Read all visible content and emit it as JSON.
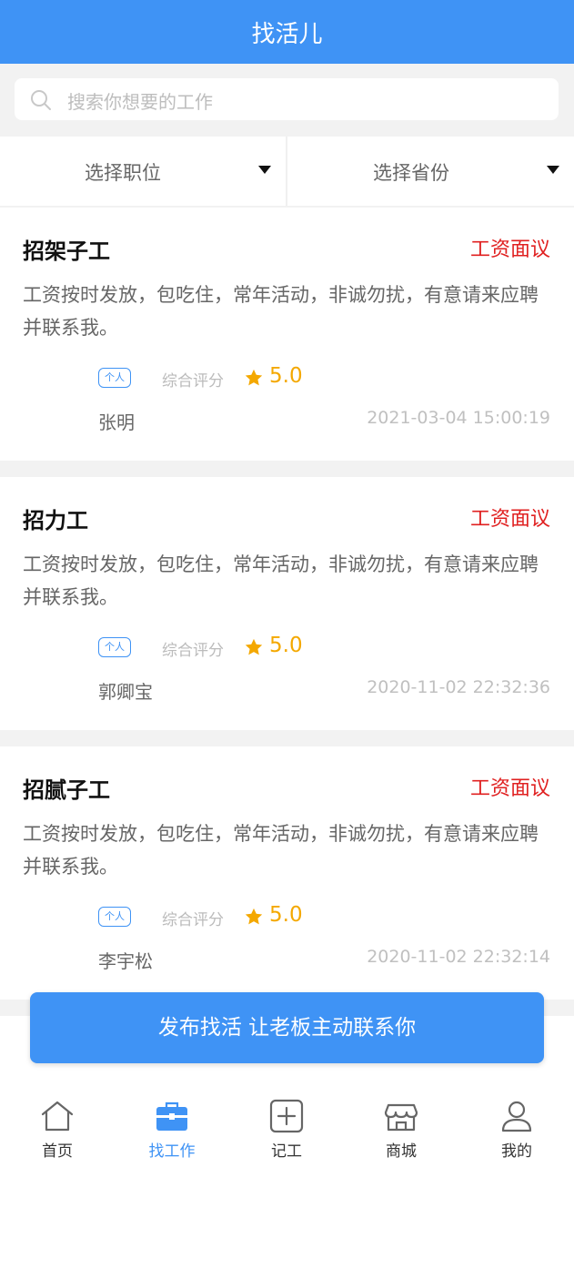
{
  "header": {
    "title": "找活儿"
  },
  "search": {
    "placeholder": "搜索你想要的工作"
  },
  "filters": {
    "position": "选择职位",
    "province": "选择省份"
  },
  "jobs": [
    {
      "title": "招架子工",
      "salary": "工资面议",
      "description": "工资按时发放，包吃住，常年活动，非诚勿扰，有意请来应聘并联系我。",
      "tag": "个人",
      "rating_label": "综合评分",
      "rating": "5.0",
      "name": "张明",
      "time": "2021-03-04 15:00:19"
    },
    {
      "title": "招力工",
      "salary": "工资面议",
      "description": "工资按时发放，包吃住，常年活动，非诚勿扰，有意请来应聘并联系我。",
      "tag": "个人",
      "rating_label": "综合评分",
      "rating": "5.0",
      "name": "郭卿宝",
      "time": "2020-11-02 22:32:36"
    },
    {
      "title": "招腻子工",
      "salary": "工资面议",
      "description": "工资按时发放，包吃住，常年活动，非诚勿扰，有意请来应聘并联系我。",
      "tag": "个人",
      "rating_label": "综合评分",
      "rating": "5.0",
      "name": "李宇松",
      "time": "2020-11-02 22:32:14"
    }
  ],
  "cta": {
    "label": "发布找活 让老板主动联系你"
  },
  "tabs": [
    {
      "label": "首页",
      "icon": "home-icon"
    },
    {
      "label": "找工作",
      "icon": "briefcase-icon"
    },
    {
      "label": "记工",
      "icon": "plus-square-icon"
    },
    {
      "label": "商城",
      "icon": "store-icon"
    },
    {
      "label": "我的",
      "icon": "user-icon"
    }
  ],
  "colors": {
    "primary": "#3f93f5",
    "salary": "#e02020",
    "star": "#f4a800"
  }
}
